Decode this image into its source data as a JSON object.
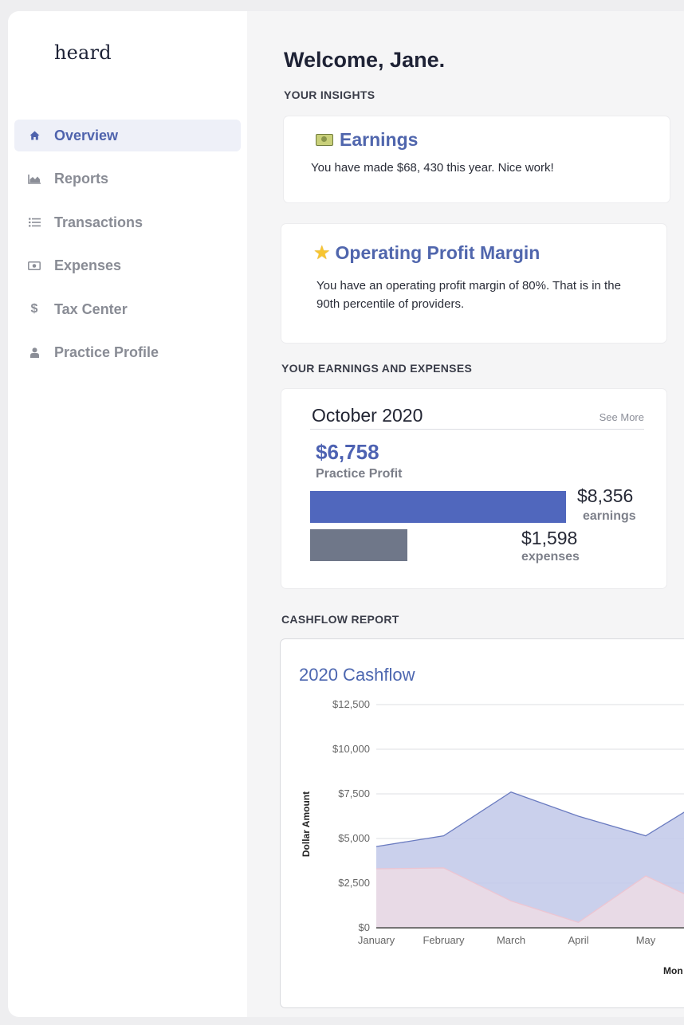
{
  "sidebar": {
    "logo": "heard",
    "items": [
      {
        "label": "Overview",
        "icon": "home-icon",
        "active": true
      },
      {
        "label": "Reports",
        "icon": "area-chart-icon",
        "active": false
      },
      {
        "label": "Transactions",
        "icon": "list-icon",
        "active": false
      },
      {
        "label": "Expenses",
        "icon": "money-icon",
        "active": false
      },
      {
        "label": "Tax Center",
        "icon": "dollar-icon",
        "active": false
      },
      {
        "label": "Practice Profile",
        "icon": "user-icon",
        "active": false
      }
    ]
  },
  "main": {
    "welcome": "Welcome, Jane.",
    "insights_label": "YOUR INSIGHTS",
    "insights": [
      {
        "icon": "money-bill-icon",
        "title": "Earnings",
        "text": "You have made $68, 430 this year. Nice work!"
      },
      {
        "icon": "star-icon",
        "title": "Operating Profit Margin",
        "text_line1": "You have an operating profit margin of 80%. That is in the",
        "text_line2": "90th percentile of providers."
      }
    ],
    "earnings_label": "YOUR EARNINGS AND EXPENSES",
    "summary": {
      "month": "October 2020",
      "see_more": "See More",
      "profit": "$6,758",
      "profit_label": "Practice Profit",
      "earnings_value": "$8,356",
      "earnings_label": "earnings",
      "expenses_value": "$1,598",
      "expenses_label": "expenses"
    },
    "cashflow_label": "CASHFLOW REPORT"
  },
  "colors": {
    "accent": "#5066ad",
    "earnings_bar": "#5067bd",
    "expenses_bar": "#6f7789",
    "area_earnings": "#c4cbea",
    "area_expenses": "#f2dde4"
  },
  "chart_data": {
    "type": "area",
    "title": "2020 Cashflow",
    "ylabel": "Dollar Amount",
    "xlabel": "Mon",
    "categories": [
      "January",
      "February",
      "March",
      "April",
      "May"
    ],
    "y_ticks": [
      "$0",
      "$2,500",
      "$5,000",
      "$7,500",
      "$10,000",
      "$12,500"
    ],
    "ylim": [
      0,
      12500
    ],
    "grid": true,
    "series": [
      {
        "values": [
          4550,
          5150,
          7600,
          6250,
          5150
        ]
      },
      {
        "values": [
          3300,
          3350,
          1500,
          300,
          2900
        ]
      }
    ]
  }
}
